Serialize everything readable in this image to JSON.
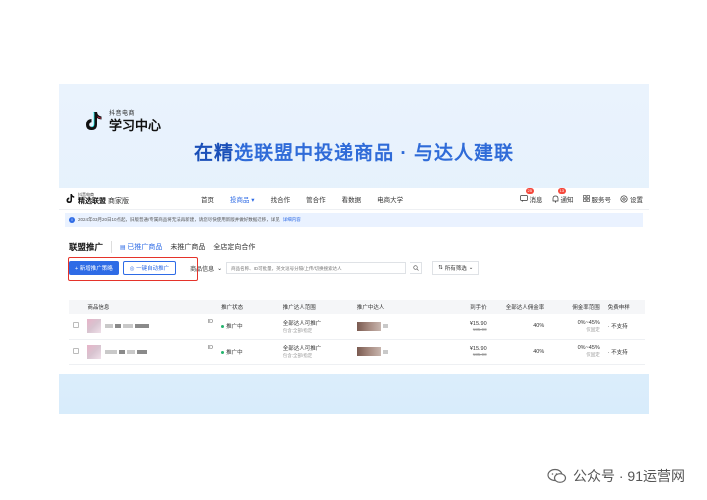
{
  "brand": {
    "small": "抖音电商",
    "big": "学习中心"
  },
  "headline": {
    "highlight": "在精",
    "rest": "选联盟中投递商品 · 与达人建联"
  },
  "app": {
    "brand_small": "抖音电商",
    "brand_big": "精选联盟",
    "brand_sub": "商家版",
    "nav": [
      "首页",
      "投商品 ▾",
      "找合作",
      "管合作",
      "看数据",
      "电商大学"
    ],
    "right": {
      "message": "消息",
      "message_badge": "25",
      "notice": "通知",
      "notice_badge": "13",
      "service": "服务号",
      "settings": "设置"
    },
    "notice_text": "2024年03月20日10点起，旧版普通/专属商品将无法再新建，请您尽快使用新版并做好数据迁移，详见",
    "notice_link": "详细内容",
    "section_title": "联盟推广",
    "tabs": [
      "已推广商品",
      "未推广商品",
      "全店定向合作"
    ],
    "btn_new": "+ 新增推广策略",
    "btn_auto": "一键自动推广",
    "select_label": "商品信息",
    "search_placeholder": "商品名称、ID可批量，英文逗号分隔/上传/切换搜索达人",
    "filter_label": "所有筛选",
    "columns": [
      "商品信息",
      "推广状态",
      "推广达人范围",
      "推广中达人",
      "到手价",
      "全部达人佣金率",
      "佣金率范围",
      "免费申样"
    ],
    "rows": [
      {
        "id_label": "ID",
        "status": "推广中",
        "scope": "全部达人可推广",
        "scope_sub": "包含:全部/指定",
        "price": "¥15.90",
        "price_orig": "¥35.90",
        "rate": "40%",
        "range": "0%~45%",
        "range_sub": "仅固定",
        "sample": "不支持"
      },
      {
        "id_label": "ID",
        "status": "推广中",
        "scope": "全部达人可推广",
        "scope_sub": "包含:全部/指定",
        "price": "¥15.90",
        "price_orig": "¥35.90",
        "rate": "40%",
        "range": "0%~45%",
        "range_sub": "仅固定",
        "sample": "不支持"
      }
    ]
  },
  "watermark": "公众号 · 91运营网"
}
